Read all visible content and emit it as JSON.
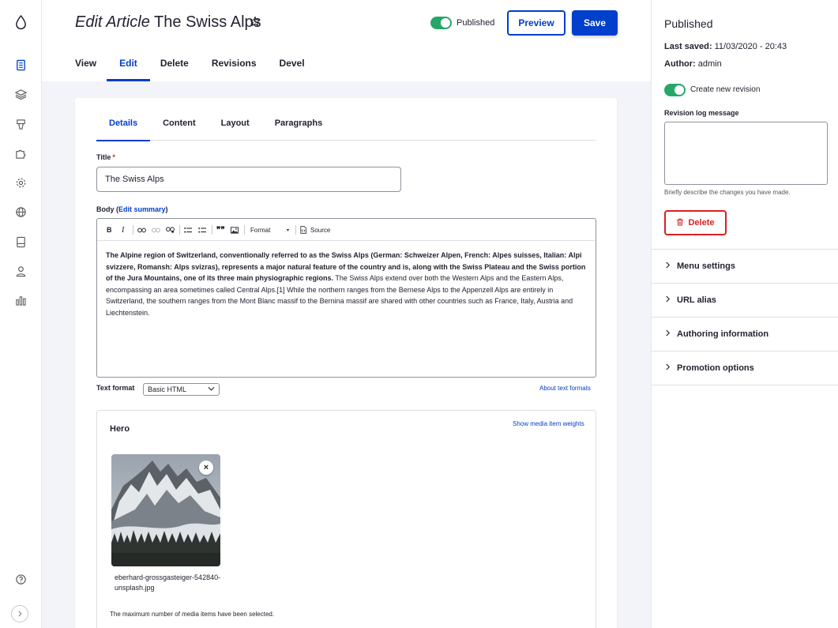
{
  "header": {
    "title_kind": "Edit Article",
    "title_name": "The Swiss Alps",
    "published_label": "Published",
    "preview_label": "Preview",
    "save_label": "Save",
    "tabs": [
      {
        "label": "View"
      },
      {
        "label": "Edit"
      },
      {
        "label": "Delete"
      },
      {
        "label": "Revisions"
      },
      {
        "label": "Devel"
      }
    ]
  },
  "form": {
    "tabs": [
      {
        "label": "Details"
      },
      {
        "label": "Content"
      },
      {
        "label": "Layout"
      },
      {
        "label": "Paragraphs"
      }
    ],
    "title_label": "Title",
    "title_required": "*",
    "title_value": "The Swiss Alps",
    "body_label_pre": "Body (",
    "body_edit_summary": "Edit summary",
    "body_label_post": ")",
    "editor_toolbar": {
      "bold": "B",
      "italic": "I",
      "blockquote": "❞❞",
      "format": "Format",
      "source": "Source"
    },
    "body_bold": "The Alpine region of Switzerland, conventionally referred to as the Swiss Alps (German: Schweizer Alpen, French: Alpes suisses, Italian: Alpi svizzere, Romansh: Alps svizras), represents a major natural feature of the country and is, along with the Swiss Plateau and the Swiss portion of the Jura Mountains, one of its three main physiographic regions.",
    "body_rest": " The Swiss Alps extend over both the Western Alps and the Eastern Alps, encompassing an area sometimes called Central Alps.[1] While the northern ranges from the Bernese Alps to the Appenzell Alps are entirely in Switzerland, the southern ranges from the Mont Blanc massif to the Bernina massif are shared with other countries such as France, Italy, Austria and Liechtenstein.",
    "text_format_label": "Text format",
    "text_format_value": "Basic HTML",
    "about_text_formats": "About text formats",
    "hero": {
      "title": "Hero",
      "weights_link": "Show media item weights",
      "remove": "×",
      "file_name": "eberhard-grossgasteiger-542840-unsplash.jpg",
      "max_message": "The maximum number of media items have been selected."
    }
  },
  "sidebar": {
    "status": "Published",
    "last_saved_label": "Last saved:",
    "last_saved_value": "11/03/2020 - 20:43",
    "author_label": "Author:",
    "author_value": "admin",
    "new_revision_label": "Create new revision",
    "revision_log_label": "Revision log message",
    "revision_help": "Briefly describe the changes you have made.",
    "delete_label": "Delete",
    "accordions": [
      {
        "label": "Menu settings"
      },
      {
        "label": "URL alias"
      },
      {
        "label": "Authoring information"
      },
      {
        "label": "Promotion options"
      }
    ]
  },
  "colors": {
    "accent": "#003ecc",
    "toggle_on": "#26a769",
    "danger": "#d72222"
  }
}
